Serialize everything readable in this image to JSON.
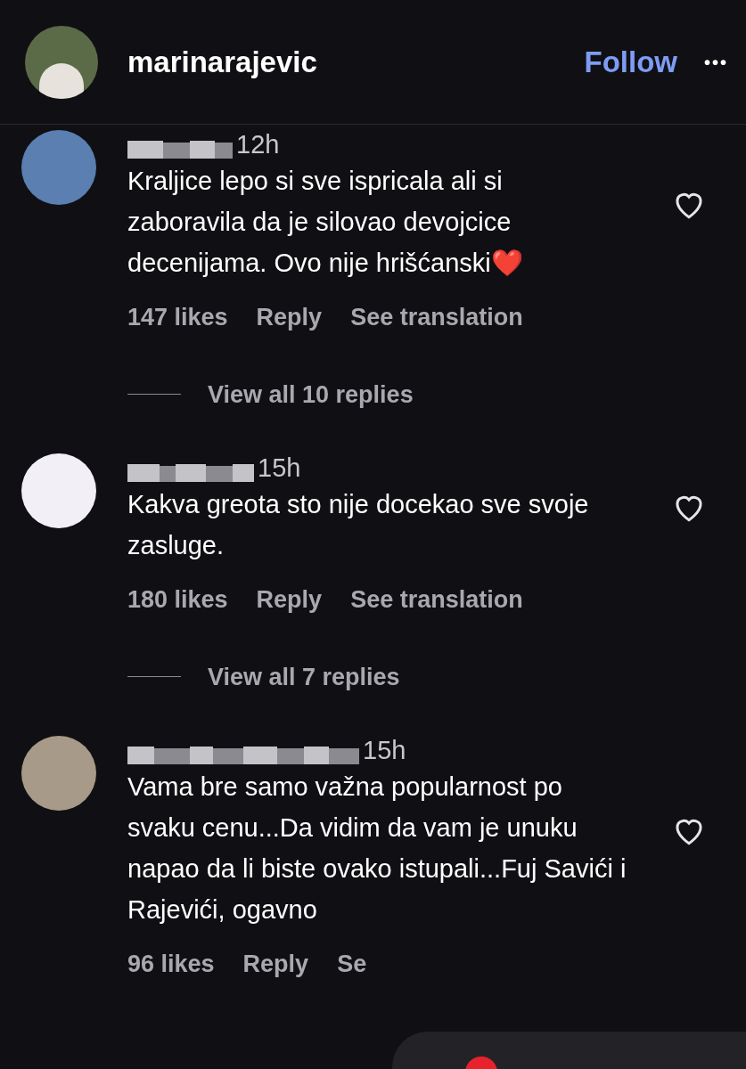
{
  "header": {
    "username": "marinarajevic",
    "follow": "Follow",
    "more": "•••"
  },
  "comments": [
    {
      "color": "#5a7fb0",
      "time": "12h",
      "text": "Kraljice lepo si sve ispricala ali si zaboravila da je silovao devojcice decenijama. Ovo nije hrišćanski",
      "emoji": "❤️",
      "likes": "147 likes",
      "reply": "Reply",
      "translate": "See translation",
      "view_replies": "View all 10 replies"
    },
    {
      "color": "#f2f0f6",
      "time": "15h",
      "text": "Kakva greota sto nije docekao sve svoje zasluge.",
      "likes": "180 likes",
      "reply": "Reply",
      "translate": "See translation",
      "view_replies": "View all 7 replies"
    },
    {
      "color": "#a89a88",
      "time": "15h",
      "text": "Vama bre samo važna popularnost po svaku cenu...Da vidim da vam je unuku napao da li biste ovako istupali...Fuj Savići i Rajevići, ogavno",
      "likes": "96 likes",
      "reply": "Reply",
      "translate": "Se"
    }
  ]
}
